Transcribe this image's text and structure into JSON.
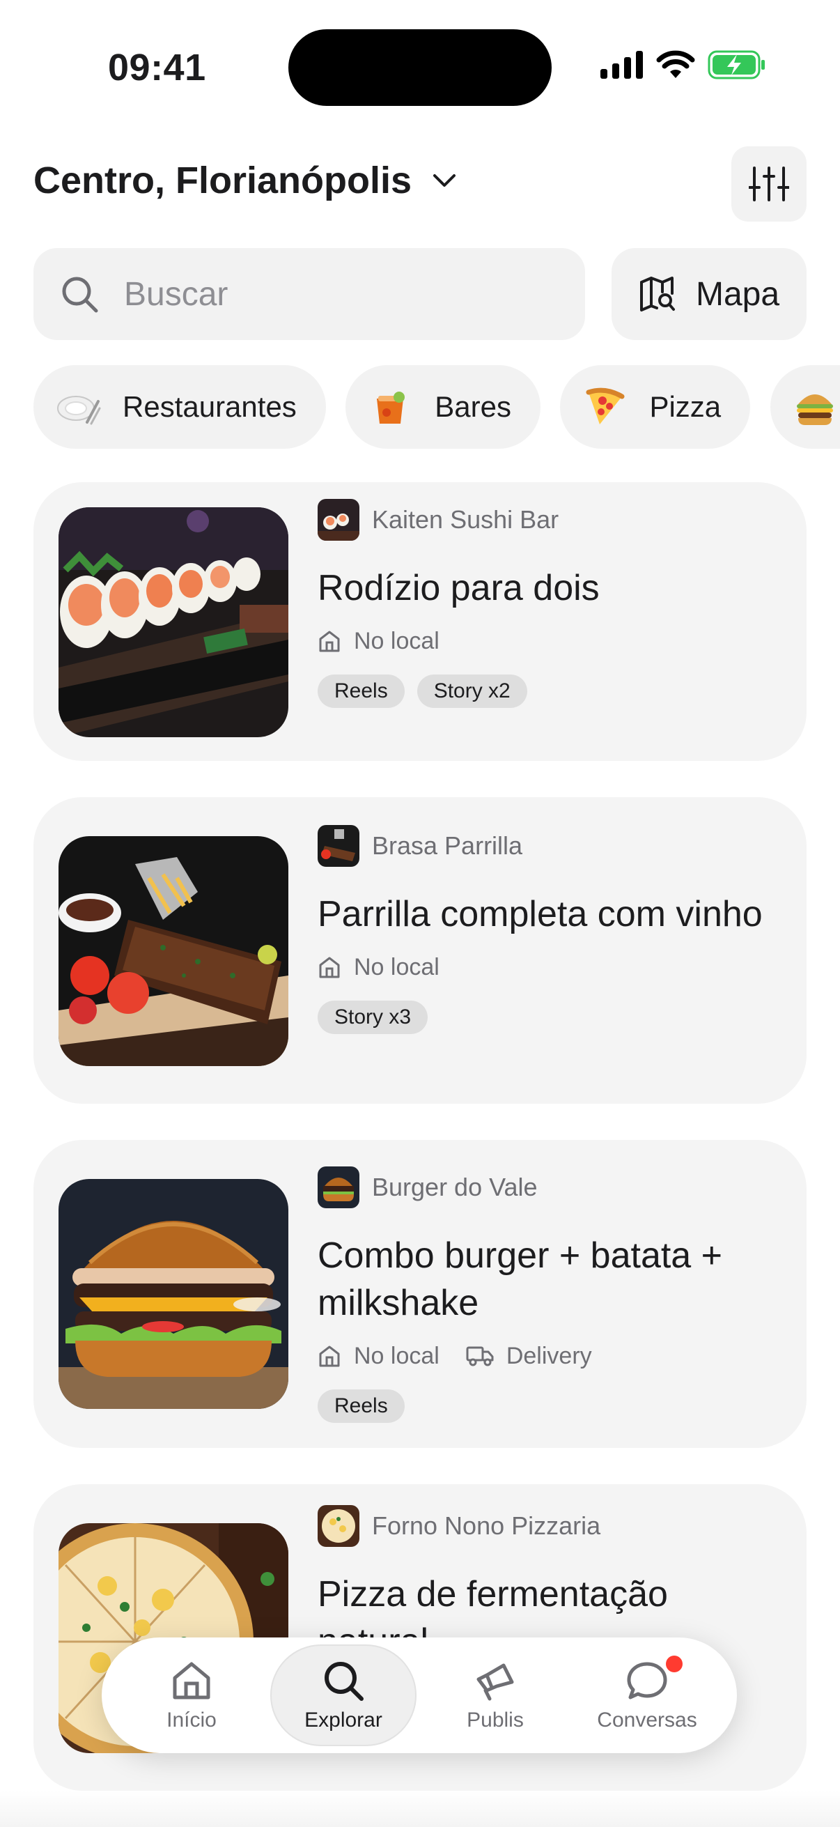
{
  "status_bar": {
    "time": "09:41"
  },
  "header": {
    "location": "Centro, Florianópolis"
  },
  "search": {
    "placeholder": "Buscar",
    "map_label": "Mapa"
  },
  "categories": [
    {
      "label": "Restaurantes",
      "icon": "plate-icon"
    },
    {
      "label": "Bares",
      "icon": "cocktail-icon"
    },
    {
      "label": "Pizza",
      "icon": "pizza-icon"
    },
    {
      "label": "",
      "icon": "burger-icon"
    }
  ],
  "offers": [
    {
      "vendor": "Kaiten Sushi Bar",
      "title": "Rodízio para dois",
      "meta": [
        "No local"
      ],
      "tags": [
        "Reels",
        "Story x2"
      ]
    },
    {
      "vendor": "Brasa Parrilla",
      "title": "Parrilla completa com vinho",
      "meta": [
        "No local"
      ],
      "tags": [
        "Story x3"
      ]
    },
    {
      "vendor": "Burger do Vale",
      "title": "Combo burger + batata + milkshake",
      "meta": [
        "No local",
        "Delivery"
      ],
      "tags": [
        "Reels"
      ]
    },
    {
      "vendor": "Forno Nono Pizzaria",
      "title": "Pizza de fermentação natural",
      "meta": [],
      "tags": []
    }
  ],
  "nav": [
    {
      "label": "Início",
      "icon": "home-icon"
    },
    {
      "label": "Explorar",
      "icon": "search-icon",
      "active": true
    },
    {
      "label": "Publis",
      "icon": "megaphone-icon"
    },
    {
      "label": "Conversas",
      "icon": "chat-icon",
      "badge": true
    }
  ],
  "colors": {
    "accent_badge": "#ff3b30",
    "battery": "#34c759",
    "card_bg": "#f4f4f4",
    "chip_bg": "#f2f2f2"
  }
}
